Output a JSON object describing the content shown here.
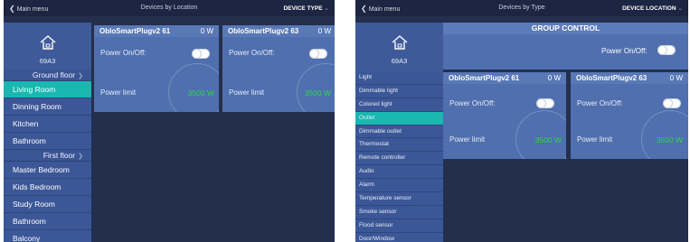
{
  "left": {
    "topbar": {
      "back_label": "Main menu",
      "title": "Devices by Location",
      "right_label": "DEVICE TYPE"
    },
    "sidebar": {
      "home_code": "69A3",
      "floors": [
        {
          "label": "Ground floor",
          "rooms": [
            "Living Room",
            "Dinning Room",
            "Kitchen",
            "Bathroom"
          ]
        },
        {
          "label": "First floor",
          "rooms": [
            "Master Bedroom",
            "Kids Bedroom",
            "Study Room",
            "Bathroom",
            "Balcony"
          ]
        }
      ],
      "active_room": "Living Room"
    },
    "cards": [
      {
        "name": "ObloSmartPlugv2 61",
        "power": "0 W",
        "power_label": "Power On/Off:",
        "limit_label": "Power limit",
        "limit_value": "3500 W"
      },
      {
        "name": "ObloSmartPlugv2 63",
        "power": "0 W",
        "power_label": "Power On/Off:",
        "limit_label": "Power limit",
        "limit_value": "3500 W"
      }
    ]
  },
  "right": {
    "topbar": {
      "back_label": "Main menu",
      "title": "Devices by Type",
      "right_label": "DEVICE LOCATION"
    },
    "sidebar": {
      "home_code": "69A3",
      "types": [
        "Light",
        "Dimmable light",
        "Colored light",
        "Outlet",
        "Dimmable outlet",
        "Thermostat",
        "Remote controller",
        "Audio",
        "Alarm",
        "Temperature sensor",
        "Smoke sensor",
        "Flood sensor",
        "Door/Window"
      ],
      "active_type": "Outlet"
    },
    "group": {
      "title": "GROUP CONTROL",
      "power_label": "Power On/Off:"
    },
    "cards": [
      {
        "name": "ObloSmartPlugv2 61",
        "power": "0 W",
        "power_label": "Power On/Off:",
        "limit_label": "Power limit",
        "limit_value": "3500 W"
      },
      {
        "name": "ObloSmartPlugv2 63",
        "power": "0 W",
        "power_label": "Power On/Off:",
        "limit_label": "Power limit",
        "limit_value": "3500 W"
      }
    ]
  },
  "colors": {
    "background": "#232f4d",
    "sidebar": "#3b5797",
    "active": "#1ab7b0",
    "card": "#4f6fae",
    "limit": "#2bd94a"
  },
  "icons": [
    "chevron-left-icon",
    "chevron-down-icon",
    "home-icon",
    "chevron-right-icon",
    "toggle-switch"
  ]
}
